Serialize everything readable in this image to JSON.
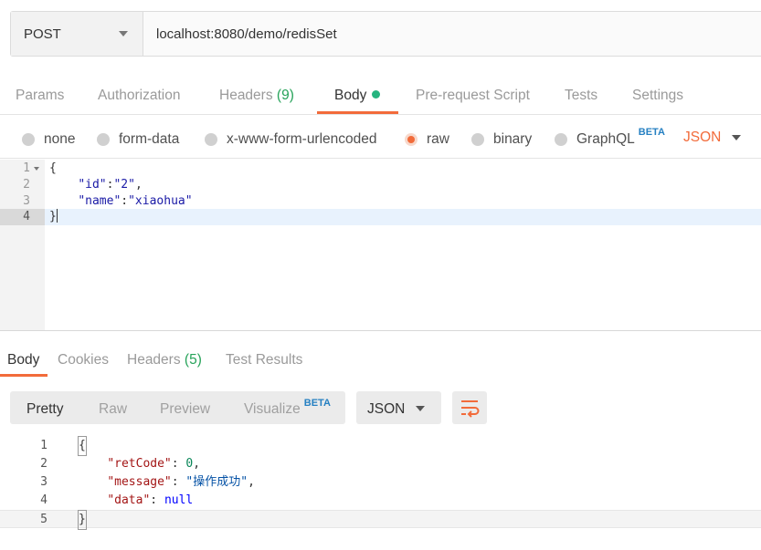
{
  "request": {
    "method": "POST",
    "url": "localhost:8080/demo/redisSet",
    "tabs": {
      "params": "Params",
      "authorization": "Authorization",
      "headers": "Headers",
      "headers_count": "(9)",
      "body": "Body",
      "prerequest": "Pre-request Script",
      "tests": "Tests",
      "settings": "Settings"
    },
    "body_types": {
      "none": "none",
      "form_data": "form-data",
      "urlencoded": "x-www-form-urlencoded",
      "raw": "raw",
      "binary": "binary",
      "graphql": "GraphQL",
      "beta": "BETA",
      "selected": "raw"
    },
    "format": "JSON",
    "editor": {
      "line_numbers": [
        "1",
        "2",
        "3",
        "4"
      ],
      "line1": "{",
      "line2_key": "\"id\"",
      "line2_sep": ":",
      "line2_val": "\"2\"",
      "line2_end": ",",
      "line3_key": "\"name\"",
      "line3_sep": ":",
      "line3_val": "\"xiaohua\"",
      "line4": "}"
    }
  },
  "response": {
    "tabs": {
      "body": "Body",
      "cookies": "Cookies",
      "headers": "Headers",
      "headers_count": "(5)",
      "test_results": "Test Results"
    },
    "view_modes": {
      "pretty": "Pretty",
      "raw": "Raw",
      "preview": "Preview",
      "visualize": "Visualize",
      "beta": "BETA"
    },
    "format": "JSON",
    "body": {
      "line_numbers": [
        "1",
        "2",
        "3",
        "4",
        "5"
      ],
      "line1": "{",
      "k_retcode": "\"retCode\"",
      "v_retcode": "0",
      "k_message": "\"message\"",
      "v_message": "\"操作成功\"",
      "k_data": "\"data\"",
      "v_data": "null",
      "line5": "}"
    }
  },
  "colors": {
    "accent": "#f26b3a",
    "count_green": "#27a35a",
    "beta_blue": "#2680c2"
  }
}
